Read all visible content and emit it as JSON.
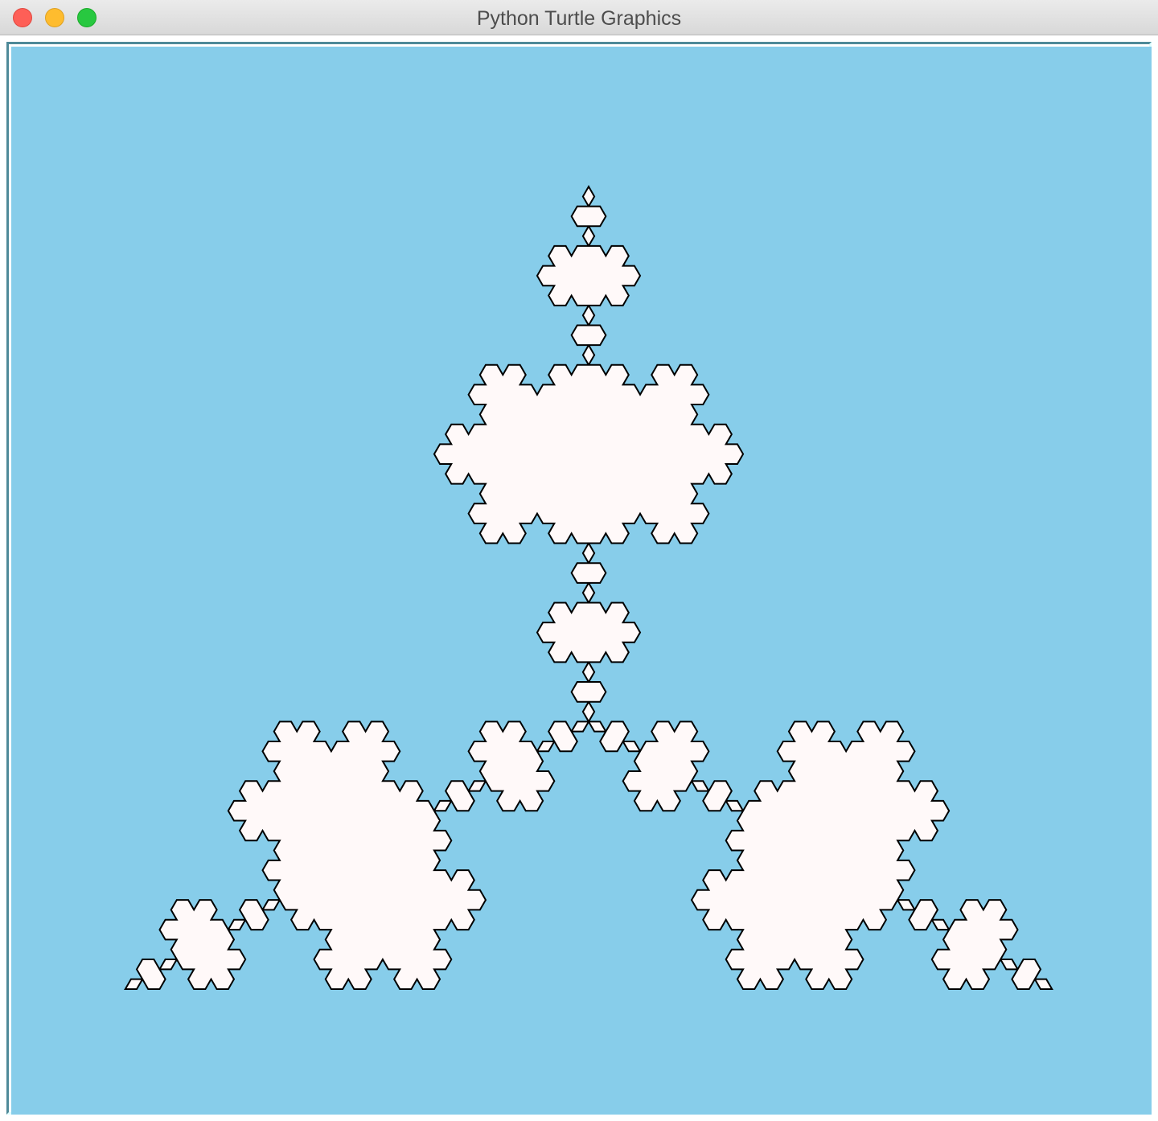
{
  "window": {
    "title": "Python Turtle Graphics"
  },
  "controls": {
    "close": "close-button",
    "minimize": "minimize-button",
    "zoom": "zoom-button"
  },
  "colors": {
    "canvas_background": "#87cdea",
    "snowflake_fill": "#fff9f9",
    "outline": "#000000",
    "close": "#fe5f57",
    "minimize": "#febc2e",
    "zoom": "#28c840"
  },
  "drawing": {
    "shape": "Koch snowflake",
    "iterations": 4
  }
}
